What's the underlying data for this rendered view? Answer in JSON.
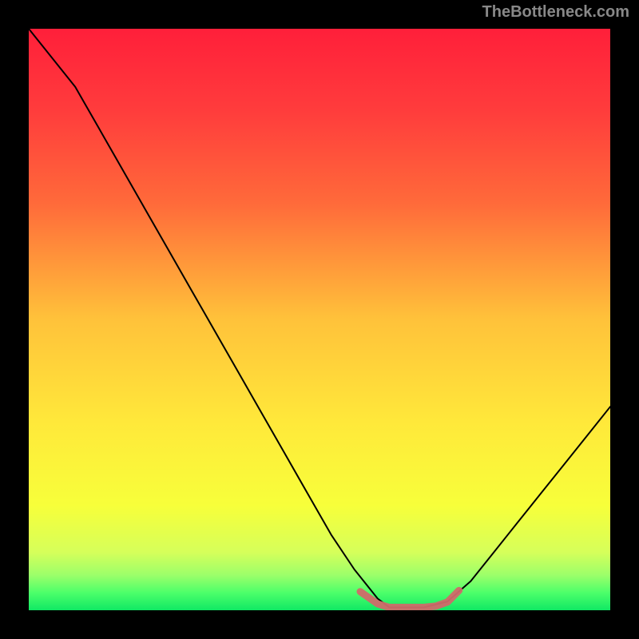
{
  "watermark": "TheBottleneck.com",
  "chart_data": {
    "type": "line",
    "title": "",
    "xlabel": "",
    "ylabel": "",
    "xlim": [
      0,
      100
    ],
    "ylim": [
      0,
      100
    ],
    "gradient": {
      "stops": [
        {
          "offset": 0,
          "color": "#ff1f3a"
        },
        {
          "offset": 0.14,
          "color": "#ff3c3c"
        },
        {
          "offset": 0.3,
          "color": "#ff6a3a"
        },
        {
          "offset": 0.5,
          "color": "#ffc23a"
        },
        {
          "offset": 0.68,
          "color": "#ffe93a"
        },
        {
          "offset": 0.82,
          "color": "#f7ff3a"
        },
        {
          "offset": 0.9,
          "color": "#d6ff5a"
        },
        {
          "offset": 0.94,
          "color": "#9bff6a"
        },
        {
          "offset": 0.97,
          "color": "#4cff6a"
        },
        {
          "offset": 1.0,
          "color": "#10e864"
        }
      ]
    },
    "curve": {
      "x": [
        0,
        4,
        8,
        12,
        16,
        20,
        24,
        28,
        32,
        36,
        40,
        44,
        48,
        52,
        56,
        60,
        62,
        64,
        68,
        72,
        76,
        80,
        84,
        88,
        92,
        96,
        100
      ],
      "y": [
        100,
        95,
        90,
        83,
        76,
        69,
        62,
        55,
        48,
        41,
        34,
        27,
        20,
        13,
        7,
        2,
        0.5,
        0.5,
        0.5,
        1.5,
        5,
        10,
        15,
        20,
        25,
        30,
        35
      ]
    },
    "low_band": {
      "x": [
        57,
        60,
        62,
        64,
        66,
        68,
        70,
        72,
        74
      ],
      "y": [
        3.2,
        1.1,
        0.5,
        0.5,
        0.5,
        0.5,
        0.7,
        1.4,
        3.4
      ]
    },
    "low_band_color": "#d06a6a",
    "low_band_width": 9
  }
}
